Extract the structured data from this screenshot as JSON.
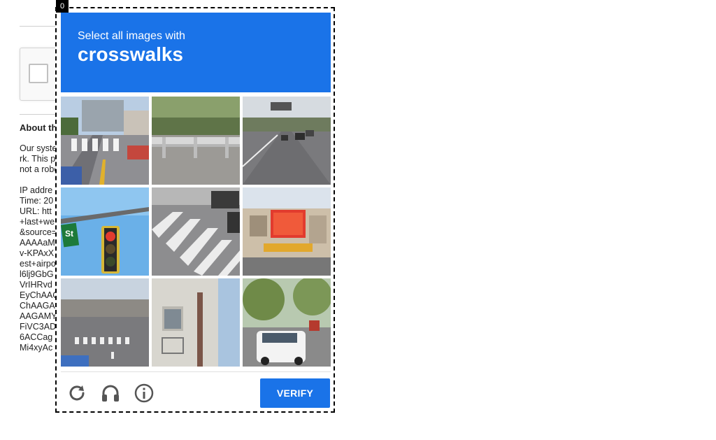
{
  "challenge": {
    "frame_index": "0",
    "prompt_text": "Select all images with",
    "target_label": "crosswalks",
    "verify_label": "VERIFY",
    "tiles": [
      {
        "description": "street-with-crosswalk"
      },
      {
        "description": "guardrail"
      },
      {
        "description": "highway-traffic"
      },
      {
        "description": "traffic-light"
      },
      {
        "description": "crosswalk-close"
      },
      {
        "description": "storefront"
      },
      {
        "description": "road-with-crosswalk"
      },
      {
        "description": "building-facade"
      },
      {
        "description": "parked-car"
      }
    ],
    "icons": [
      "reload-icon",
      "audio-icon",
      "info-icon"
    ]
  },
  "background": {
    "about_heading": "About th",
    "lines": [
      "Our syste",
      "rk. This p",
      "not a robo",
      "",
      "IP addre",
      "Time: 20",
      "URL: htt",
      "+last+we",
      "&source=",
      "AAAAaM",
      "v-KPAxX",
      "est+airpo",
      "l6lj9GbG",
      "VrIHRvd",
      "EyChAAC",
      "ChAAGA",
      "AAGAMY",
      "FiVC3AD",
      "6ACCag",
      "Mi4xyAc"
    ]
  }
}
